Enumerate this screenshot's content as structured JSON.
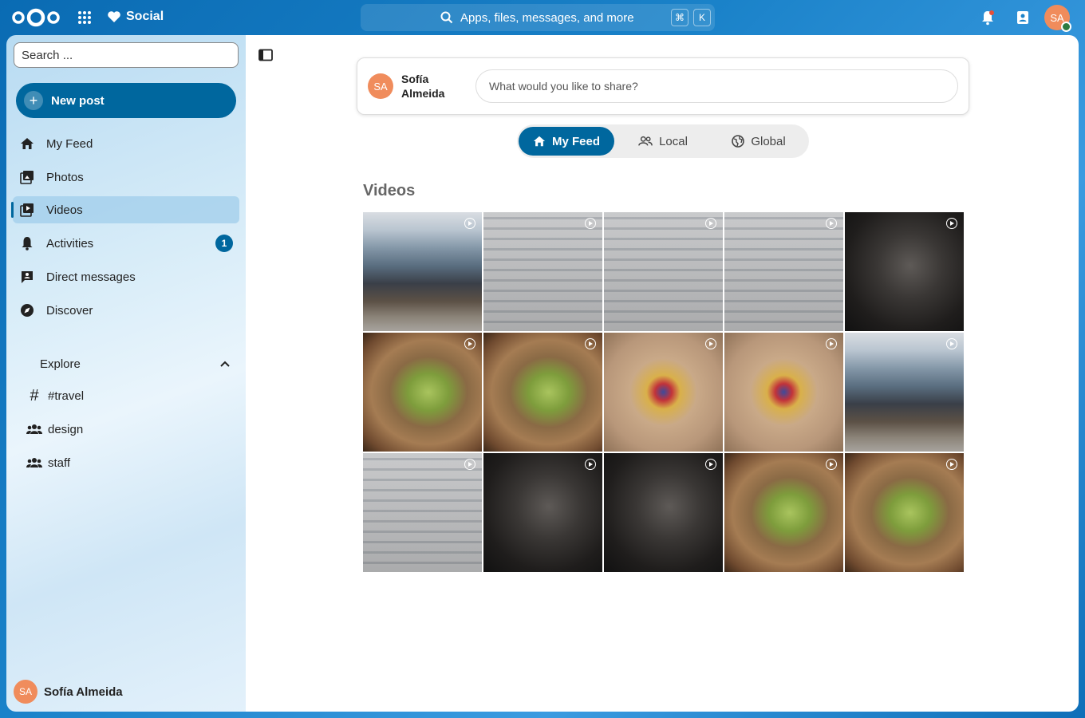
{
  "topbar": {
    "app_name": "Social",
    "search_placeholder": "Apps, files, messages, and more",
    "kbd_cmd": "⌘",
    "kbd_k": "K",
    "user_initials": "SA"
  },
  "sidebar": {
    "search_placeholder": "Search ...",
    "new_post_label": "New post",
    "items": [
      {
        "label": "My Feed",
        "icon": "home-icon"
      },
      {
        "label": "Photos",
        "icon": "photos-icon"
      },
      {
        "label": "Videos",
        "icon": "videos-icon",
        "active": true
      },
      {
        "label": "Activities",
        "icon": "bell-icon",
        "badge": "1"
      },
      {
        "label": "Direct messages",
        "icon": "message-icon"
      },
      {
        "label": "Discover",
        "icon": "compass-icon"
      }
    ],
    "explore_label": "Explore",
    "explore_items": [
      {
        "label": "#travel",
        "icon": "hashtag-icon"
      },
      {
        "label": "design",
        "icon": "group-icon"
      },
      {
        "label": "staff",
        "icon": "group-icon"
      }
    ],
    "user_name": "Sofía Almeida",
    "user_initials": "SA"
  },
  "composer": {
    "user_initials": "SA",
    "user_name": "Sofía Almeida",
    "placeholder": "What would you like to share?"
  },
  "tabs": [
    {
      "label": "My Feed",
      "active": true
    },
    {
      "label": "Local"
    },
    {
      "label": "Global"
    }
  ],
  "section_title": "Videos",
  "videos": [
    "crowd",
    "library",
    "library",
    "library",
    "gorilla",
    "frog",
    "frog",
    "bird",
    "bird",
    "crowd",
    "library",
    "gorilla",
    "gorilla",
    "frog",
    "frog"
  ],
  "colors": {
    "primary": "#00679e",
    "avatar": "#f08c5c"
  }
}
